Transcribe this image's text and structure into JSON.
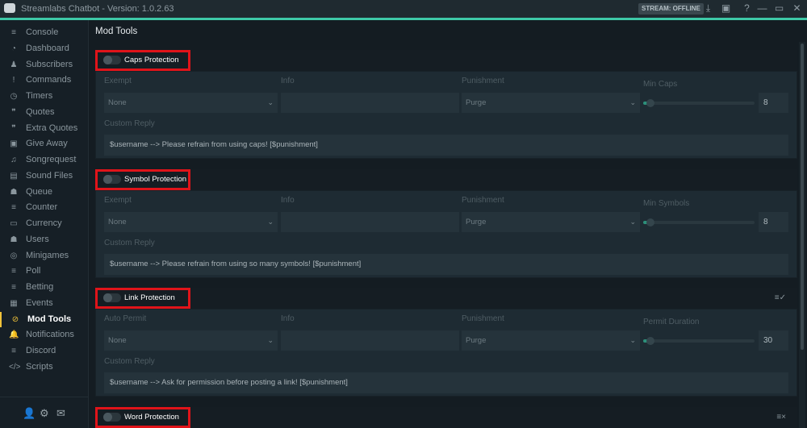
{
  "window": {
    "title": "Streamlabs Chatbot - Version: 1.0.2.63",
    "stream_status": "STREAM: OFFLINE"
  },
  "sidebar": {
    "items": [
      {
        "label": "Console",
        "icon": "≡",
        "name": "list-icon"
      },
      {
        "label": "Dashboard",
        "icon": "◔",
        "name": "dashboard-icon"
      },
      {
        "label": "Subscribers",
        "icon": "♟",
        "name": "person-icon"
      },
      {
        "label": "Commands",
        "icon": "!",
        "name": "exclamation-icon"
      },
      {
        "label": "Timers",
        "icon": "◷",
        "name": "clock-icon"
      },
      {
        "label": "Quotes",
        "icon": "❞",
        "name": "quote-icon"
      },
      {
        "label": "Extra Quotes",
        "icon": "❞",
        "name": "quote-icon"
      },
      {
        "label": "Give Away",
        "icon": "▣",
        "name": "gift-icon"
      },
      {
        "label": "Songrequest",
        "icon": "♫",
        "name": "music-icon"
      },
      {
        "label": "Sound Files",
        "icon": "▤",
        "name": "file-icon"
      },
      {
        "label": "Queue",
        "icon": "☗",
        "name": "users-icon"
      },
      {
        "label": "Counter",
        "icon": "≡",
        "name": "list-icon"
      },
      {
        "label": "Currency",
        "icon": "▭",
        "name": "money-icon"
      },
      {
        "label": "Users",
        "icon": "☗",
        "name": "users-icon"
      },
      {
        "label": "Minigames",
        "icon": "◎",
        "name": "gamepad-icon"
      },
      {
        "label": "Poll",
        "icon": "≡",
        "name": "list-icon"
      },
      {
        "label": "Betting",
        "icon": "≡",
        "name": "list-icon"
      },
      {
        "label": "Events",
        "icon": "▦",
        "name": "calendar-icon"
      },
      {
        "label": "Mod Tools",
        "icon": "⊘",
        "name": "ban-icon",
        "active": true
      },
      {
        "label": "Notifications",
        "icon": "🔔",
        "name": "bell-icon"
      },
      {
        "label": "Discord",
        "icon": "≡",
        "name": "list-icon"
      },
      {
        "label": "Scripts",
        "icon": "</>",
        "name": "code-icon"
      }
    ]
  },
  "main": {
    "title": "Mod Tools",
    "sections": [
      {
        "title": "Caps Protection",
        "col1_label": "Exempt",
        "col1_value": "None",
        "info_label": "Info",
        "info_value": "",
        "punish_label": "Punishment",
        "punish_value": "Purge",
        "slider_label": "Min Caps",
        "slider_value": "8",
        "reply_label": "Custom Reply",
        "reply_value": "$username --> Please refrain from using caps! [$punishment]",
        "header_icon": ""
      },
      {
        "title": "Symbol Protection",
        "col1_label": "Exempt",
        "col1_value": "None",
        "info_label": "Info",
        "info_value": "",
        "punish_label": "Punishment",
        "punish_value": "Purge",
        "slider_label": "Min Symbols",
        "slider_value": "8",
        "reply_label": "Custom Reply",
        "reply_value": "$username --> Please refrain from using so many symbols! [$punishment]",
        "header_icon": ""
      },
      {
        "title": "Link Protection",
        "col1_label": "Auto Permit",
        "col1_value": "None",
        "info_label": "Info",
        "info_value": "",
        "punish_label": "Punishment",
        "punish_value": "Purge",
        "slider_label": "Permit Duration",
        "slider_value": "30",
        "reply_label": "Custom Reply",
        "reply_value": "$username --> Ask for permission before posting a link! [$punishment]",
        "header_icon": "≡✓"
      },
      {
        "title": "Word Protection",
        "header_icon": "≡×"
      }
    ]
  }
}
